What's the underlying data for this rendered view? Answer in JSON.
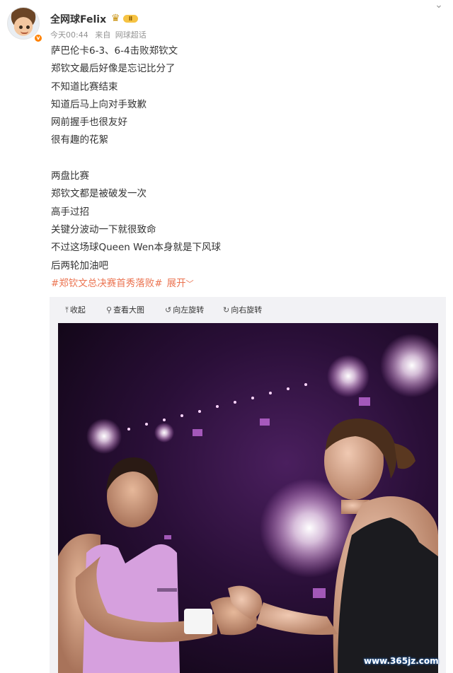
{
  "post": {
    "username": "全网球Felix",
    "vip_level": "Ⅱ",
    "time": "今天00:44",
    "source_prefix": "来自",
    "source": "网球超话",
    "lines": [
      "萨巴伦卡6-3、6-4击败郑钦文",
      "郑钦文最后好像是忘记比分了",
      "不知道比赛结束",
      "知道后马上向对手致歉",
      "网前握手也很友好",
      "很有趣的花絮",
      "",
      "两盘比赛",
      "郑钦文都是被破发一次",
      "高手过招",
      "关键分波动一下就很致命",
      "不过这场球Queen Wen本身就是下风球",
      "后两轮加油吧"
    ],
    "topic": "#郑钦文总决赛首秀落败#",
    "expand_label": "展开"
  },
  "toolbar": {
    "collapse_label": "收起",
    "view_large_label": "查看大图",
    "rotate_left_label": "向左旋转",
    "rotate_right_label": "向右旋转"
  },
  "icons": {
    "collapse": "arrow-up-icon",
    "view_large": "magnifier-icon",
    "rotate_left": "rotate-left-icon",
    "rotate_right": "rotate-right-icon",
    "more": "chevron-down-icon"
  },
  "colors": {
    "accent": "#eb7350",
    "vip_badge": "#ff8200"
  },
  "watermark": "www.365jz.com"
}
